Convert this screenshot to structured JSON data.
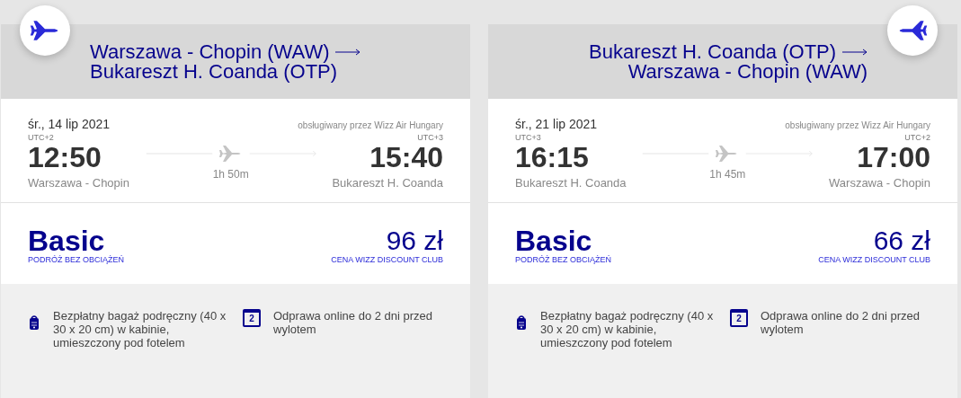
{
  "flights": [
    {
      "kind": "outbound",
      "route_from": "Warszawa - Chopin (WAW)",
      "route_to": "Bukareszt H. Coanda (OTP)",
      "date": "śr., 14 lip 2021",
      "operator": "obsługiwany przez Wizz Air Hungary",
      "dep_tz": "UTC+2",
      "dep_time": "12:50",
      "dep_airport": "Warszawa - Chopin",
      "duration": "1h 50m",
      "arr_tz": "UTC+3",
      "arr_time": "15:40",
      "arr_airport": "Bukareszt H. Coanda",
      "fare": "Basic",
      "fare_sub": "PODRÓŻ BEZ OBCIĄŻEŃ",
      "price": "96 zł",
      "price_sub": "CENA WIZZ DISCOUNT CLUB",
      "benefits": [
        {
          "kind": "bag",
          "text": "Bezpłatny bagaż podręczny (40 x 30 x 20 cm) w kabinie, umieszczony pod fotelem"
        },
        {
          "kind": "calendar",
          "icon_text": "2",
          "text": "Odprawa online do 2 dni przed wylotem"
        }
      ]
    },
    {
      "kind": "return",
      "route_from": "Bukareszt H. Coanda (OTP)",
      "route_to": "Warszawa - Chopin (WAW)",
      "date": "śr., 21 lip 2021",
      "operator": "obsługiwany przez Wizz Air Hungary",
      "dep_tz": "UTC+3",
      "dep_time": "16:15",
      "dep_airport": "Bukareszt H. Coanda",
      "duration": "1h 45m",
      "arr_tz": "UTC+2",
      "arr_time": "17:00",
      "arr_airport": "Warszawa - Chopin",
      "fare": "Basic",
      "fare_sub": "PODRÓŻ BEZ OBCIĄŻEŃ",
      "price": "66 zł",
      "price_sub": "CENA WIZZ DISCOUNT CLUB",
      "benefits": [
        {
          "kind": "bag",
          "text": "Bezpłatny bagaż podręczny (40 x 30 x 20 cm) w kabinie, umieszczony pod fotelem"
        },
        {
          "kind": "calendar",
          "icon_text": "2",
          "text": "Odprawa online do 2 dni przed wylotem"
        }
      ]
    }
  ]
}
